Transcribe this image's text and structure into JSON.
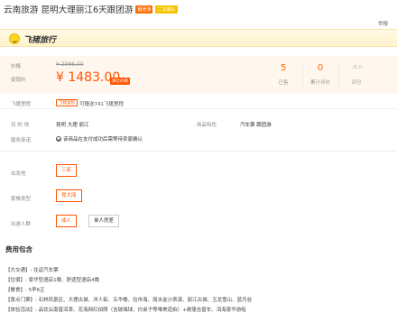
{
  "title": {
    "text": "云南旅游 昆明大理丽江6天跟团游",
    "tag1": "跟团游",
    "tag2": "二次确认"
  },
  "report_label": "举报",
  "logo": {
    "text": "飞猪旅行"
  },
  "price": {
    "original_label": "价格",
    "original_price": "¥ 2966.00",
    "promo_label": "促销价",
    "promo_price": "¥ 1483.00",
    "promo_tag": "清仓价格"
  },
  "stats": [
    {
      "value": "5",
      "label": "已售"
    },
    {
      "value": "0",
      "label": "累计评价"
    },
    {
      "value": "-/5.0",
      "label": "评分"
    }
  ],
  "points": {
    "label": "飞猪里程",
    "badge": "飞猪里程",
    "text": "可赠送741飞猪里程"
  },
  "info": {
    "destination_label": "目 的 地",
    "destination_value": "昆明  大理  丽江",
    "feature_label": "商品特色",
    "feature_value": "汽车票  跟团游",
    "service_label": "服务承诺",
    "service_value": "该商品在支付成功后需等待卖家确认"
  },
  "options": {
    "departure_label": "出发地",
    "departure_value": "三亚",
    "package_label": "套餐类型",
    "package_value": "昆大丽",
    "people_label": "出游人群",
    "people_values": [
      "成人",
      "单人房差"
    ]
  },
  "fee": {
    "title": "费用包含",
    "lines": [
      "【大交通】: 往返汽车票",
      "【住宿】: 豪华型酒店1晚、舒适型酒店4晚",
      "【餐食】: 5早6正",
      "【景点门票】: 石林风景区、大理古城、洋人街、五华楼、拉市海、丽水金沙表演、丽江古城、玉龙雪山、蓝月谷",
      "【体验活动】: 品饮云南普洱茶、花海网红拍照（含玻璃球、白桌子等唯美道拍）+敞篷吉普车、洱海豪华游船"
    ]
  },
  "colors": {
    "accent": "#ff5500",
    "brand_yellow": "#ffd51f"
  }
}
